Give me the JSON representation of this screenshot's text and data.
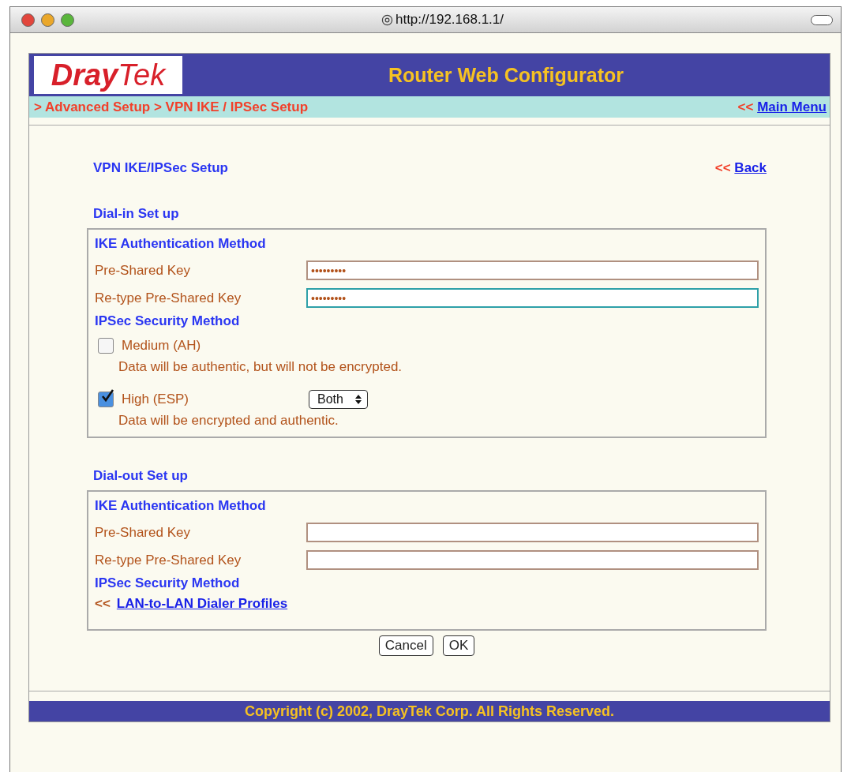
{
  "window": {
    "url": "http://192.168.1.1/"
  },
  "header": {
    "logo_left": "Dray",
    "logo_right": "Tek",
    "title": "Router Web Configurator"
  },
  "breadcrumb": {
    "path": "> Advanced Setup > VPN IKE / IPSec Setup",
    "marker": "<<",
    "link": "Main Menu"
  },
  "page": {
    "title": "VPN IKE/IPSec Setup",
    "back_marker": "<<",
    "back_link": "Back"
  },
  "sections": [
    {
      "heading": "Dial-in Set up",
      "items": [
        {
          "kind": "heading",
          "text": "IKE Authentication Method"
        },
        {
          "kind": "field",
          "label": "Pre-Shared Key",
          "value": "•••••••••",
          "focused": false
        },
        {
          "kind": "field",
          "label": "Re-type Pre-Shared Key",
          "value": "•••••••••",
          "focused": true
        },
        {
          "kind": "heading",
          "text": "IPSec Security Method"
        },
        {
          "kind": "checkbox",
          "label": "Medium (AH)",
          "checked": false,
          "note": "Data will be authentic, but will not be encrypted."
        },
        {
          "kind": "checkbox",
          "label": "High (ESP)",
          "checked": true,
          "select": "Both",
          "note": "Data will be encrypted and authentic."
        }
      ]
    },
    {
      "heading": "Dial-out Set up",
      "items": [
        {
          "kind": "heading",
          "text": "IKE Authentication Method"
        },
        {
          "kind": "field",
          "label": "Pre-Shared Key",
          "value": "",
          "focused": false
        },
        {
          "kind": "field",
          "label": "Re-type Pre-Shared Key",
          "value": "",
          "focused": false
        },
        {
          "kind": "heading",
          "text": "IPSec Security Method"
        },
        {
          "kind": "link",
          "marker": "<<",
          "text": "LAN-to-LAN Dialer Profiles"
        }
      ]
    }
  ],
  "buttons": [
    "Cancel",
    "OK"
  ],
  "footer": "Copyright (c) 2002, DrayTek Corp. All Rights Reserved."
}
